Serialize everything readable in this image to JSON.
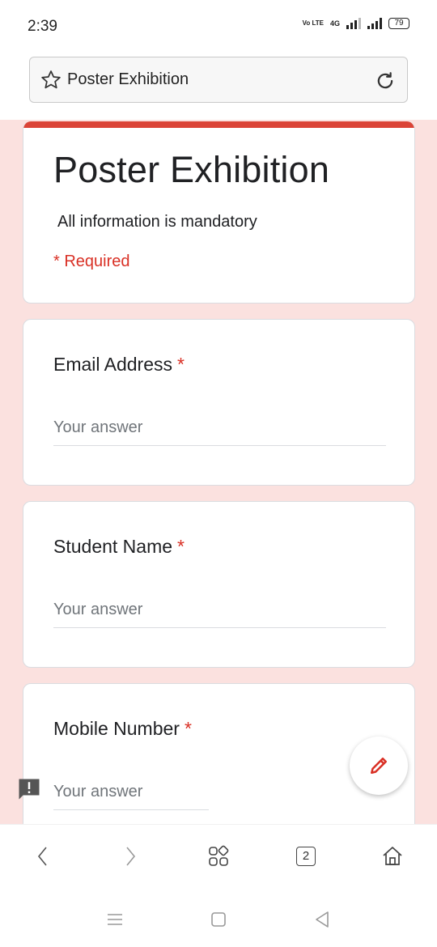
{
  "status_bar": {
    "time": "2:39",
    "volte": "Vo LTE",
    "network": "4G",
    "battery": "79"
  },
  "address_bar": {
    "title": "Poster Exhibition",
    "star_icon": "star-outline-icon",
    "reload_icon": "reload-icon"
  },
  "form": {
    "accent_color": "#db4437",
    "background_color": "#fbe1df",
    "title": "Poster Exhibition",
    "description": "All information is mandatory",
    "required_note": "* Required",
    "required_color": "#d93025",
    "questions": [
      {
        "label": "Email Address",
        "required_marker": "*",
        "placeholder": "Your answer"
      },
      {
        "label": "Student Name",
        "required_marker": "*",
        "placeholder": "Your answer"
      },
      {
        "label": "Mobile Number",
        "required_marker": "*",
        "placeholder": "Your answer"
      }
    ],
    "edit_fab_icon": "pencil-icon",
    "report_icon": "feedback-icon"
  },
  "browser_nav": {
    "back_icon": "chevron-left-icon",
    "forward_icon": "chevron-right-icon",
    "menu_icon": "grid-menu-icon",
    "tab_count": "2",
    "home_icon": "home-icon"
  },
  "system_nav": {
    "recents_icon": "recents-icon",
    "home_icon": "square-home-icon",
    "back_icon": "triangle-back-icon"
  }
}
